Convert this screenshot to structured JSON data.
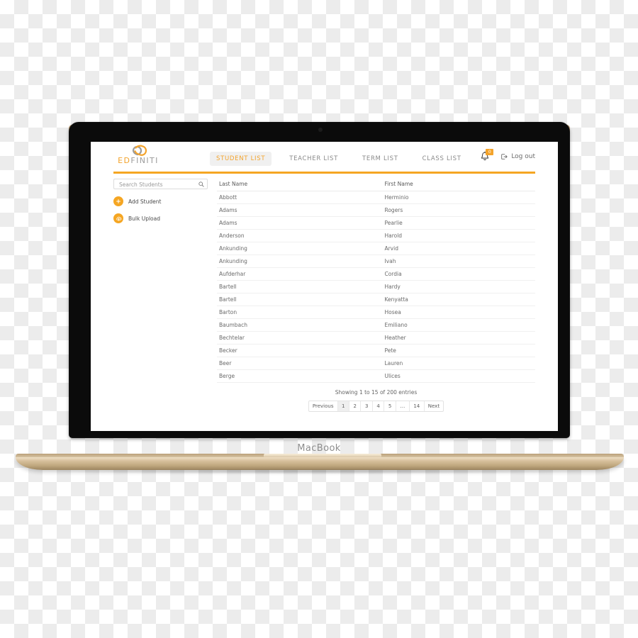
{
  "device": {
    "label": "MacBook"
  },
  "app": {
    "logo": {
      "icon": "infinity-loop-icon",
      "word_first": "ED",
      "word_second": "FINITI"
    },
    "nav": [
      {
        "label": "STUDENT LIST",
        "active": true
      },
      {
        "label": "TEACHER LIST",
        "active": false
      },
      {
        "label": "TERM LIST",
        "active": false
      },
      {
        "label": "CLASS LIST",
        "active": false
      }
    ],
    "header_right": {
      "notification_icon": "bell-icon",
      "notification_count": "0",
      "logout_icon": "logout-icon",
      "logout_label": "Log out"
    },
    "accent_color": "#F5A623",
    "accent_text_color": "#F3A32B"
  },
  "sidebar": {
    "search": {
      "placeholder": "Search Students",
      "value": "",
      "icon": "search-icon"
    },
    "actions": [
      {
        "label": "Add Student",
        "icon": "plus-icon"
      },
      {
        "label": "Bulk Upload",
        "icon": "cloud-upload-icon"
      }
    ]
  },
  "table": {
    "columns": [
      "Last Name",
      "First Name"
    ],
    "rows": [
      [
        "Abbott",
        "Herminio"
      ],
      [
        "Adams",
        "Rogers"
      ],
      [
        "Adams",
        "Pearlie"
      ],
      [
        "Anderson",
        "Harold"
      ],
      [
        "Ankunding",
        "Arvid"
      ],
      [
        "Ankunding",
        "Ivah"
      ],
      [
        "Aufderhar",
        "Cordia"
      ],
      [
        "Bartell",
        "Hardy"
      ],
      [
        "Bartell",
        "Kenyatta"
      ],
      [
        "Barton",
        "Hosea"
      ],
      [
        "Baumbach",
        "Emiliano"
      ],
      [
        "Bechtelar",
        "Heather"
      ],
      [
        "Becker",
        "Pete"
      ],
      [
        "Beer",
        "Lauren"
      ],
      [
        "Berge",
        "Ulices"
      ]
    ],
    "info": "Showing 1 to 15 of 200 entries",
    "pagination": {
      "previous": "Previous",
      "pages": [
        "1",
        "2",
        "3",
        "4",
        "5",
        "…",
        "14"
      ],
      "active_page": "1",
      "next": "Next"
    }
  }
}
